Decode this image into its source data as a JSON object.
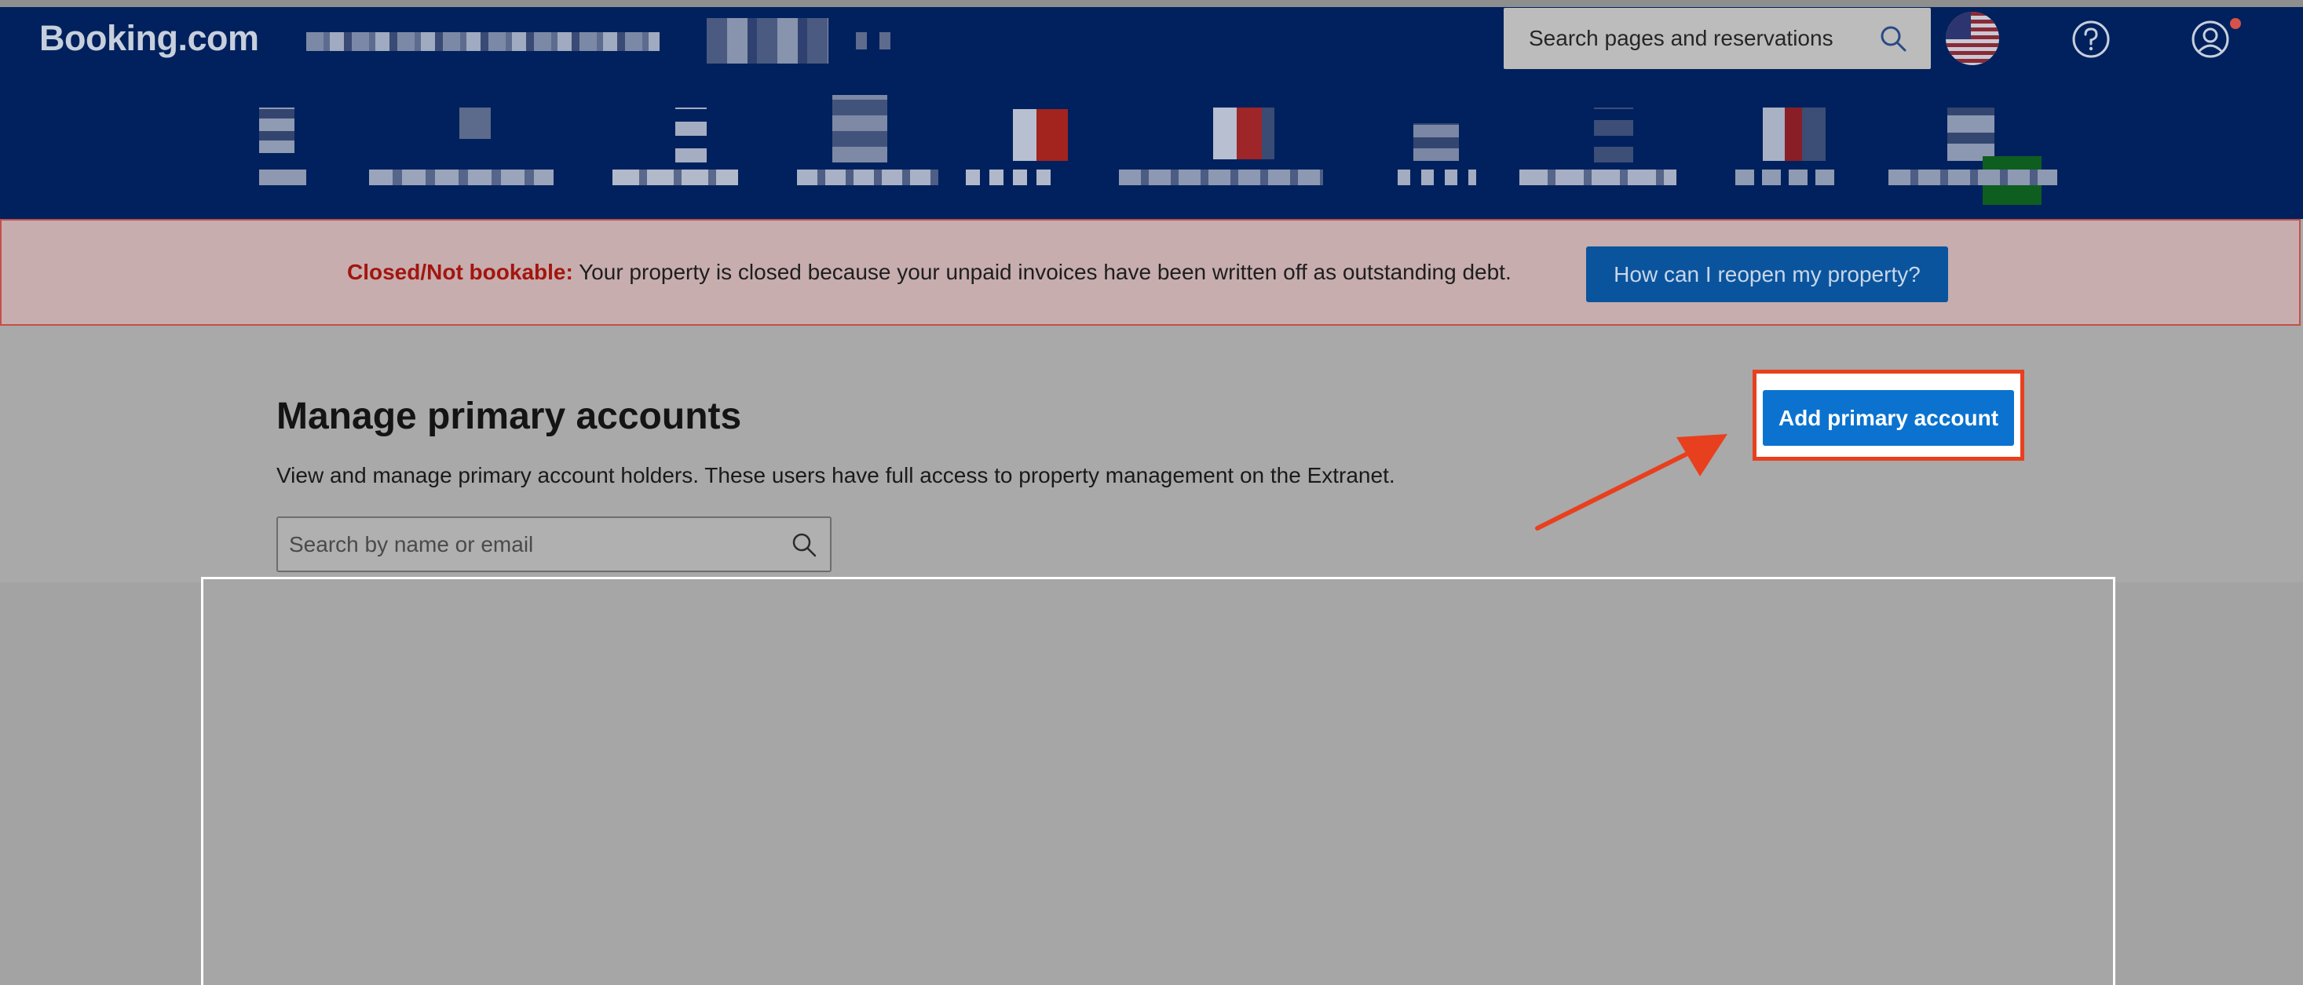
{
  "header": {
    "brand": "Booking.com",
    "search_placeholder": "Search pages and reservations"
  },
  "alert": {
    "label": "Closed/Not bookable:",
    "message": "Your property is closed because your unpaid invoices have been written off as outstanding debt.",
    "button_label": "How can I reopen my property?"
  },
  "main": {
    "title": "Manage primary accounts",
    "description": "View and manage primary account holders. These users have full access to property management on the Extranet.",
    "search_placeholder": "Search by name or email",
    "add_button_label": "Add primary account"
  },
  "colors": {
    "header_bg": "#00215d",
    "alert_label": "#a3150f",
    "primary_button": "#0b73cf",
    "highlight": "#e8401f"
  }
}
